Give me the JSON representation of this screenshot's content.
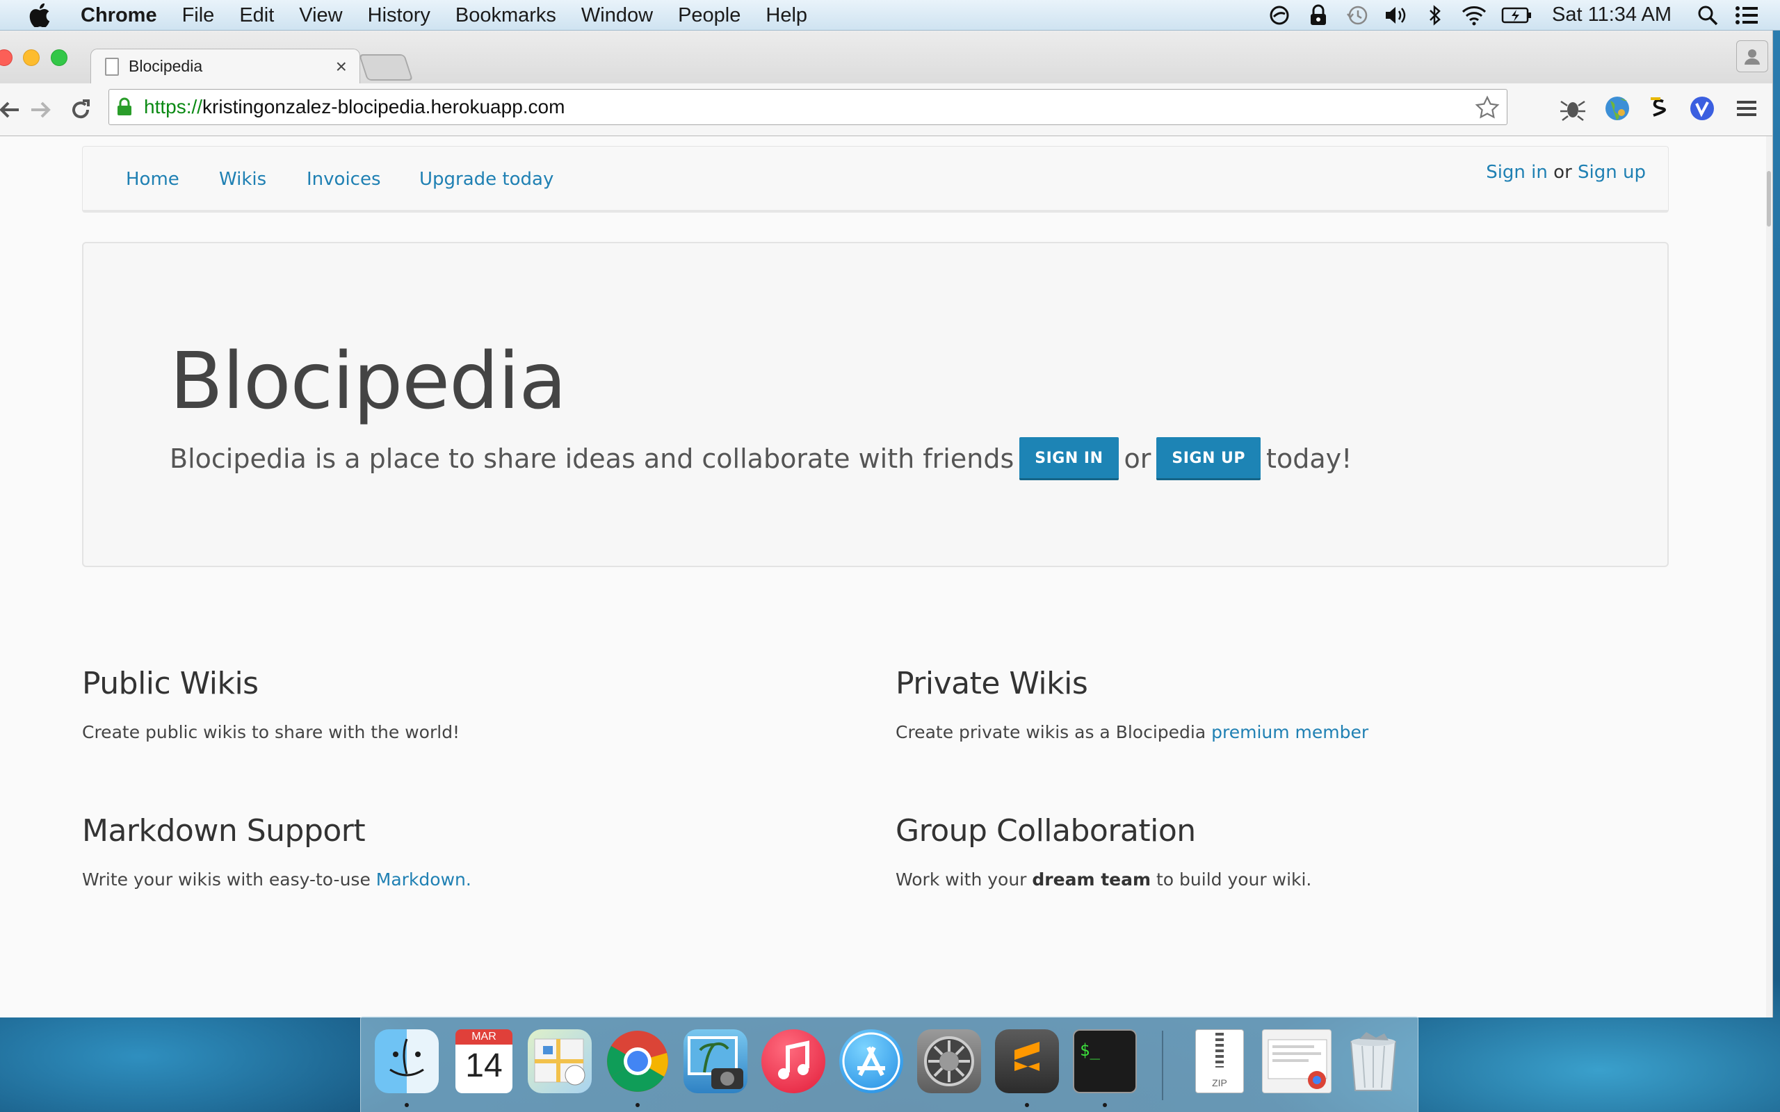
{
  "menubar": {
    "app_name": "Chrome",
    "menus": [
      "File",
      "Edit",
      "View",
      "History",
      "Bookmarks",
      "Window",
      "People",
      "Help"
    ],
    "clock": "Sat 11:34 AM",
    "status_icons": [
      "sync-icon",
      "lock-icon",
      "time-machine-icon",
      "volume-icon",
      "bluetooth-icon",
      "wifi-icon",
      "battery-icon",
      "spotlight-icon",
      "notification-center-icon"
    ]
  },
  "browser": {
    "tab_title": "Blocipedia",
    "url_scheme": "https://",
    "url_host": "kristingonzalez-blocipedia.herokuapp.com",
    "extensions": [
      "bug-extension-icon",
      "globe-extension-icon",
      "s-extension-icon",
      "v-extension-icon"
    ]
  },
  "site_nav": {
    "links": [
      "Home",
      "Wikis",
      "Invoices",
      "Upgrade today"
    ],
    "sign_in": "Sign in",
    "or": "or",
    "sign_up": "Sign up"
  },
  "hero": {
    "title": "Blocipedia",
    "lead": "Blocipedia is a place to share ideas and collaborate with friends",
    "sign_in_button": "SIGN IN",
    "or": "or",
    "sign_up_button": "SIGN UP",
    "today": "today!"
  },
  "features": {
    "public": {
      "title": "Public Wikis",
      "text": "Create public wikis to share with the world!"
    },
    "private": {
      "title": "Private Wikis",
      "text": "Create private wikis as a Blocipedia ",
      "link": "premium member"
    },
    "markdown": {
      "title": "Markdown Support",
      "text": "Write your wikis with easy-to-use ",
      "link": "Markdown."
    },
    "group": {
      "title": "Group Collaboration",
      "text_before": "Work with your ",
      "bold": "dream team",
      "text_after": " to build your wiki."
    }
  },
  "dock": {
    "calendar_month": "MAR",
    "calendar_day": "14",
    "zip_label": "ZIP",
    "apps": [
      "finder-icon",
      "calendar-icon",
      "maps-icon",
      "chrome-icon",
      "iphoto-icon",
      "itunes-icon",
      "app-store-icon",
      "system-preferences-icon",
      "sublime-text-icon",
      "terminal-icon",
      "zip-file-icon",
      "downloads-stack-icon",
      "trash-icon"
    ]
  },
  "colors": {
    "link": "#1f80b3",
    "button": "#1d84b5",
    "url_green": "#0b8a14"
  }
}
